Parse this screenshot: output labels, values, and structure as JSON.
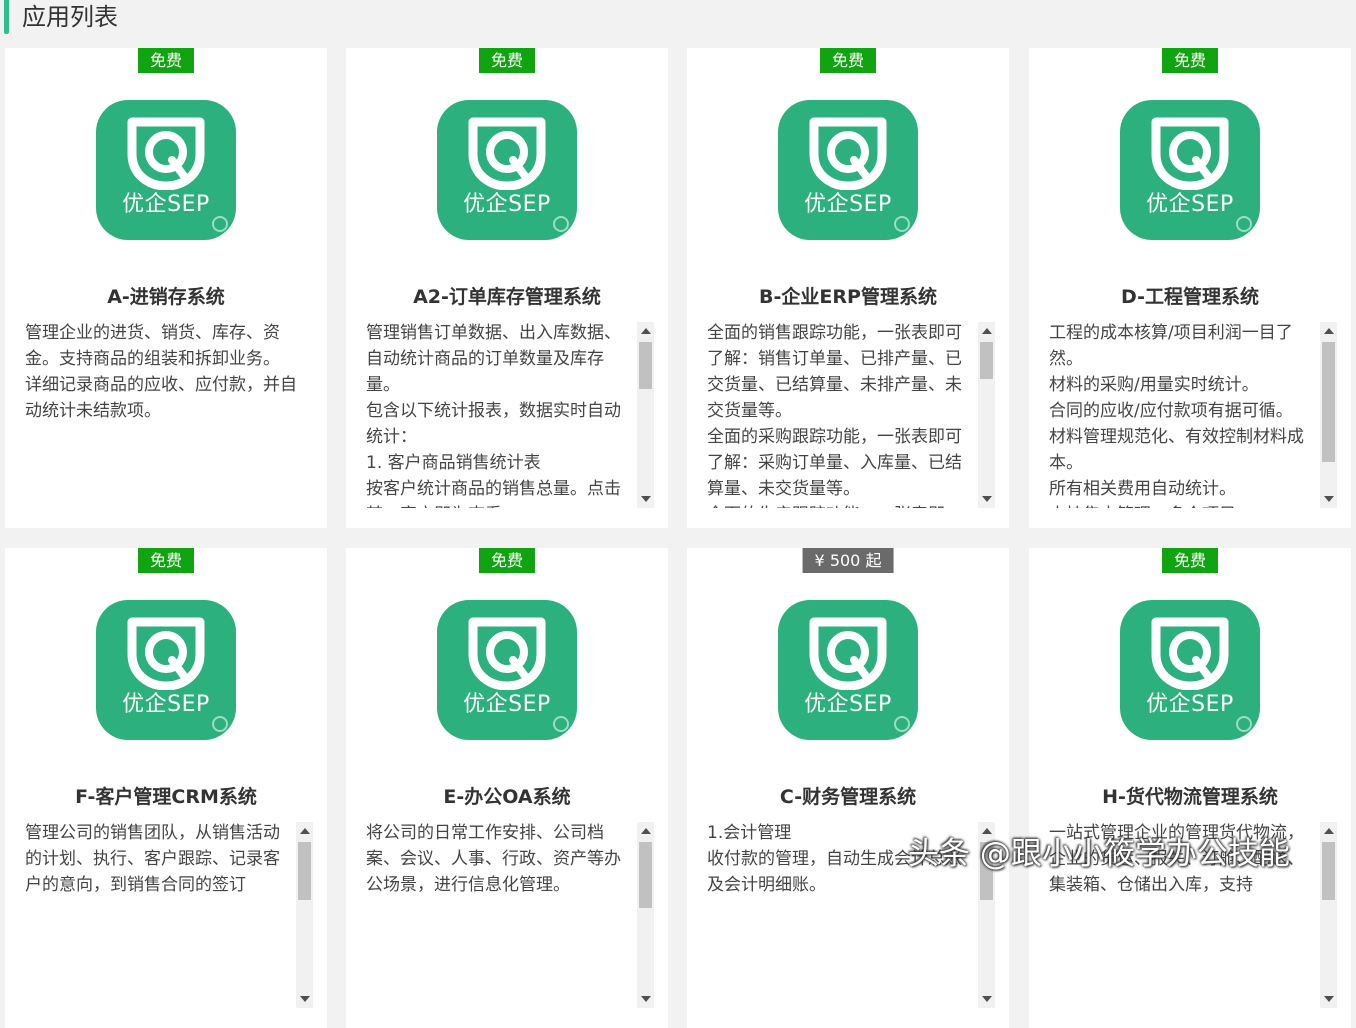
{
  "header": {
    "title": "应用列表",
    "accent_color": "#2bc08c"
  },
  "logo": {
    "text": "优企SEP",
    "background": "#2bb07e",
    "icon": "app-logo-icon"
  },
  "badge_colors": {
    "free": "#10a510",
    "paid": "#6a6a6a"
  },
  "cards": [
    {
      "badge": "免费",
      "badge_type": "free",
      "title": "A-进销存系统",
      "desc": [
        "管理企业的进货、销货、库存、资金。支持商品的组装和拆卸业务。",
        "详细记录商品的应收、应付款，并自动统计未结款项。"
      ],
      "scrollable": false
    },
    {
      "badge": "免费",
      "badge_type": "free",
      "title": "A2-订单库存管理系统",
      "desc": [
        "管理销售订单数据、出入库数据、自动统计商品的订单数量及库存量。",
        "包含以下统计报表，数据实时自动统计：",
        "1. 客户商品销售统计表",
        "按客户统计商品的销售总量。点击某一客户即为查看"
      ],
      "scrollable": true,
      "thumb_fraction": 0.32,
      "thumb_offset": 0.0
    },
    {
      "badge": "免费",
      "badge_type": "free",
      "title": "B-企业ERP管理系统",
      "desc": [
        "全面的销售跟踪功能，一张表即可了解：销售订单量、已排产量、已交货量、已结算量、未排产量、未交货量等。",
        "全面的采购跟踪功能，一张表即可了解：采购订单量、入库量、已结算量、未交货量等。",
        "全面的生产跟踪功能，一张表即"
      ],
      "scrollable": true,
      "thumb_fraction": 0.25,
      "thumb_offset": 0.0
    },
    {
      "badge": "免费",
      "badge_type": "free",
      "title": "D-工程管理系统",
      "desc": [
        "工程的成本核算/项目利润一目了然。",
        "材料的采购/用量实时统计。",
        "合同的应收/应付款项有据可循。",
        "材料管理规范化、有效控制材料成本。",
        "所有相关费用自动统计。",
        "支持集中管理、多个项目"
      ],
      "scrollable": true,
      "thumb_fraction": 0.82,
      "thumb_offset": 0.0
    },
    {
      "badge": "免费",
      "badge_type": "free",
      "title": "F-客户管理CRM系统",
      "desc": [
        "管理公司的销售团队，从销售活动的计划、执行、客户跟踪、记录客户的意向，到销售合同的签订"
      ],
      "scrollable": true,
      "thumb_fraction": 0.4,
      "thumb_offset": 0.0
    },
    {
      "badge": "免费",
      "badge_type": "free",
      "title": "E-办公OA系统",
      "desc": [
        "将公司的日常工作安排、公司档案、会议、人事、行政、资产等办公场景，进行信息化管理。"
      ],
      "scrollable": true,
      "thumb_fraction": 0.45,
      "thumb_offset": 0.0
    },
    {
      "badge": "¥ 500 起",
      "badge_type": "paid",
      "title": "C-财务管理系统",
      "desc": [
        "1.会计管理",
        "收付款的管理，自动生成会计总账及会计明细账。"
      ],
      "scrollable": true,
      "thumb_fraction": 0.4,
      "thumb_offset": 0.0
    },
    {
      "badge": "免费",
      "badge_type": "free",
      "title": "H-货代物流管理系统",
      "desc": [
        "一站式管理企业的管理货代物流，企业的货运、报关、订舱、配送、集装箱、仓储出入库，支持"
      ],
      "scrollable": true,
      "thumb_fraction": 0.4,
      "thumb_offset": 0.0
    }
  ],
  "watermark": "头条 @跟小小筱学办公技能"
}
